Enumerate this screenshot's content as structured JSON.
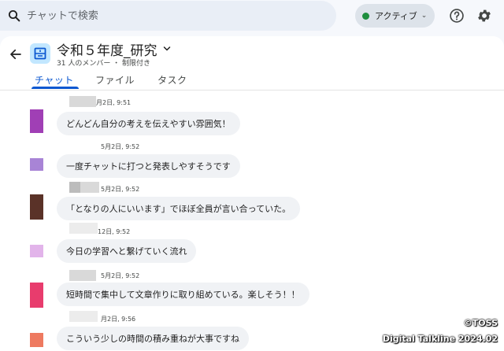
{
  "search": {
    "placeholder": "チャットで検索"
  },
  "status": {
    "label": "アクティブ"
  },
  "space": {
    "title": "令和５年度_研究",
    "subtitle": "31 人のメンバー ・ 制限付き"
  },
  "tabs": [
    {
      "label": "チャット"
    },
    {
      "label": "ファイル"
    },
    {
      "label": "タスク"
    }
  ],
  "messages": [
    {
      "meta": "月2日, 9:51",
      "text": "どんどん自分の考えを伝えやすい雰囲気！",
      "avatar_color": "#a03fb5"
    },
    {
      "meta": "5月2日, 9:52",
      "text": "一度チャットに打つと発表しやすそうです",
      "avatar_color": "#a884d6"
    },
    {
      "meta": "5月2日, 9:52",
      "text": "「となりの人にいいます」でほぼ全員が言い合っていた。",
      "avatar_color": "#5a3228"
    },
    {
      "meta": "12日, 9:52",
      "text": "今日の学習へと繋げていく流れ",
      "avatar_color": "#e2b4ea"
    },
    {
      "meta": "5月2日, 9:52",
      "text": "短時間で集中して文章作りに取り組めている。楽しそう！！",
      "avatar_color": "#e83c6d"
    },
    {
      "meta": "月2日, 9:56",
      "text": "こういう少しの時間の積み重ねが大事ですね",
      "avatar_color": "#ee7a60"
    }
  ],
  "watermark": {
    "line1": "©TOSS",
    "line2": "Digital Talkline 2024.02"
  }
}
